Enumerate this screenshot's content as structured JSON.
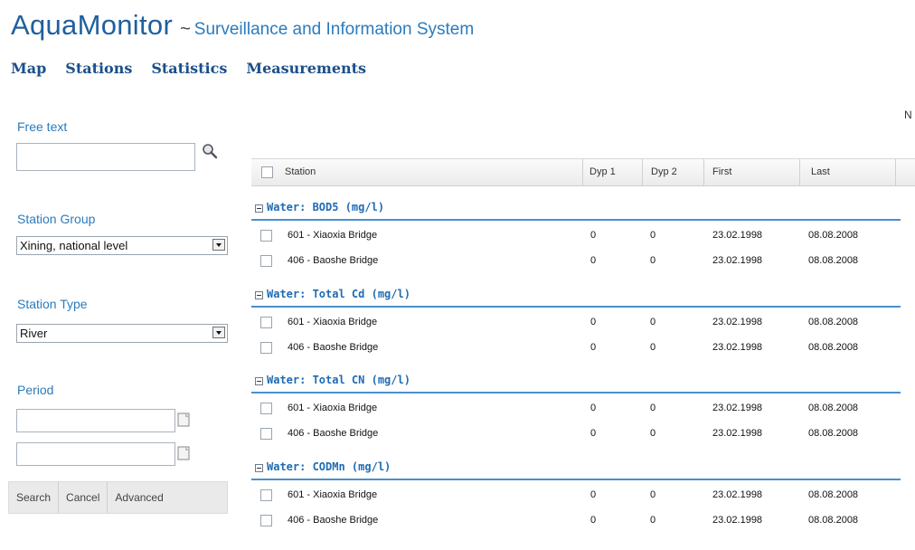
{
  "header": {
    "app_name": "AquaMonitor",
    "separator": "~",
    "subtitle": "Surveillance and Information System"
  },
  "nav": [
    {
      "label": "Map"
    },
    {
      "label": "Stations"
    },
    {
      "label": "Statistics"
    },
    {
      "label": "Measurements"
    }
  ],
  "truncated_label": "N",
  "sidebar": {
    "free_text_label": "Free text",
    "free_text_value": "",
    "search_icon": "magnifier-icon",
    "station_group_label": "Station Group",
    "station_group_value": "Xining, national level",
    "station_type_label": "Station Type",
    "station_type_value": "River",
    "period_label": "Period",
    "period_from": "",
    "period_to": "",
    "buttons": {
      "search": "Search",
      "cancel": "Cancel",
      "advanced": "Advanced"
    }
  },
  "grid": {
    "columns": {
      "station": "Station",
      "dyp1": "Dyp 1",
      "dyp2": "Dyp 2",
      "first": "First",
      "last": "Last"
    },
    "groups": [
      {
        "title": "Water: BOD5 (mg/l)",
        "rows": [
          {
            "station": "601 - Xiaoxia Bridge",
            "dyp1": "0",
            "dyp2": "0",
            "first": "23.02.1998",
            "last": "08.08.2008"
          },
          {
            "station": "406 - Baoshe Bridge",
            "dyp1": "0",
            "dyp2": "0",
            "first": "23.02.1998",
            "last": "08.08.2008"
          }
        ]
      },
      {
        "title": "Water: Total Cd (mg/l)",
        "rows": [
          {
            "station": "601 - Xiaoxia Bridge",
            "dyp1": "0",
            "dyp2": "0",
            "first": "23.02.1998",
            "last": "08.08.2008"
          },
          {
            "station": "406 - Baoshe Bridge",
            "dyp1": "0",
            "dyp2": "0",
            "first": "23.02.1998",
            "last": "08.08.2008"
          }
        ]
      },
      {
        "title": "Water: Total CN (mg/l)",
        "rows": [
          {
            "station": "601 - Xiaoxia Bridge",
            "dyp1": "0",
            "dyp2": "0",
            "first": "23.02.1998",
            "last": "08.08.2008"
          },
          {
            "station": "406 - Baoshe Bridge",
            "dyp1": "0",
            "dyp2": "0",
            "first": "23.02.1998",
            "last": "08.08.2008"
          }
        ]
      },
      {
        "title": "Water: CODMn (mg/l)",
        "rows": [
          {
            "station": "601 - Xiaoxia Bridge",
            "dyp1": "0",
            "dyp2": "0",
            "first": "23.02.1998",
            "last": "08.08.2008"
          },
          {
            "station": "406 - Baoshe Bridge",
            "dyp1": "0",
            "dyp2": "0",
            "first": "23.02.1998",
            "last": "08.08.2008"
          }
        ]
      }
    ]
  },
  "colors": {
    "brand": "#1f5f9e",
    "link": "#2b7bbd",
    "group_rule": "#4a8fce"
  }
}
